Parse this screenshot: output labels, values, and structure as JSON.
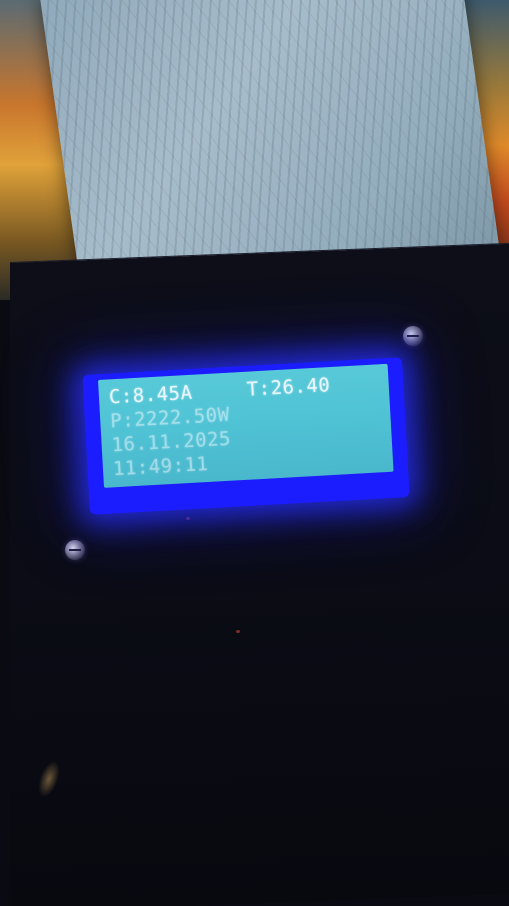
{
  "lcd": {
    "line1": {
      "current": "C:8.45A",
      "temperature": "T:26.40"
    },
    "line2": {
      "power": "P:2222.50W"
    },
    "line3": {
      "date": "16.11.2025"
    },
    "line4": {
      "time": "11:49:11"
    }
  },
  "colors": {
    "lcd_background": "#4fc2d4",
    "lcd_backlight": "#1b1dff",
    "lcd_text": "#e9f6ff",
    "enclosure": "#0b0c15"
  }
}
